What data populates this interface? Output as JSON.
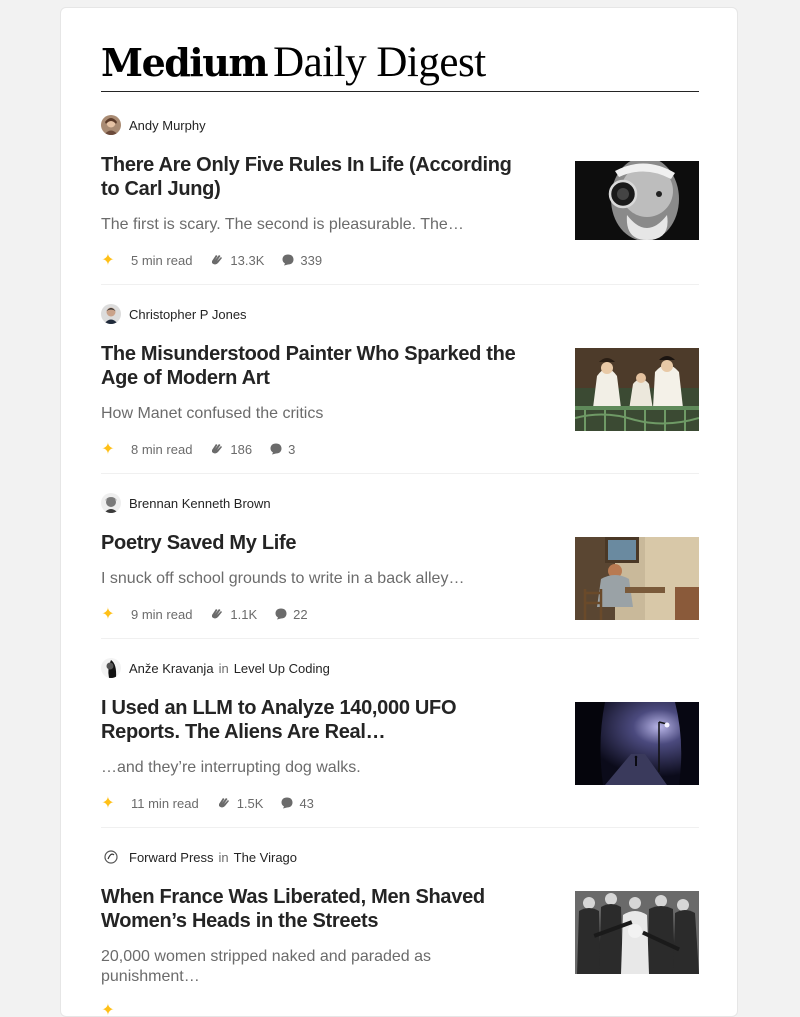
{
  "brand": "Medium",
  "digest": "Daily Digest",
  "articles": [
    {
      "author": "Andy Murphy",
      "publication": "",
      "in_word": "",
      "title": "There Are Only Five Rules In Life (According to Carl Jung)",
      "subtitle": "The first is scary. The second is pleasurable. The…",
      "read_time": "5 min read",
      "claps": "13.3K",
      "responses": "339",
      "thumb_icon": "old-man-monocle-photo"
    },
    {
      "author": "Christopher P Jones",
      "publication": "",
      "in_word": "",
      "title": "The Misunderstood Painter Who Sparked the Age of Modern Art",
      "subtitle": "How Manet confused the critics",
      "read_time": "8 min read",
      "claps": "186",
      "responses": "3",
      "thumb_icon": "manet-balcony-painting"
    },
    {
      "author": "Brennan Kenneth Brown",
      "publication": "",
      "in_word": "",
      "title": "Poetry Saved My Life",
      "subtitle": "I snuck off school grounds to write in a back alley…",
      "read_time": "9 min read",
      "claps": "1.1K",
      "responses": "22",
      "thumb_icon": "woman-at-desk-painting"
    },
    {
      "author": "Anže Kravanja",
      "publication": "Level Up Coding",
      "in_word": "in",
      "title": "I Used an LLM to Analyze 140,000 UFO Reports. The Aliens Are Real…",
      "subtitle": "…and they’re interrupting dog walks.",
      "read_time": "11 min read",
      "claps": "1.5K",
      "responses": "43",
      "thumb_icon": "night-street-lamp-photo"
    },
    {
      "author": "Forward Press",
      "publication": "The Virago",
      "in_word": "in",
      "title": "When France Was Liberated, Men Shaved Women’s Heads in the Streets",
      "subtitle": "20,000 women stripped naked and paraded as punishment…",
      "read_time": "",
      "claps": "",
      "responses": "",
      "thumb_icon": "crowd-black-white-photo"
    }
  ],
  "colors": {
    "star": "#ffc017",
    "text_primary": "#242424",
    "text_secondary": "#6b6b6b"
  }
}
